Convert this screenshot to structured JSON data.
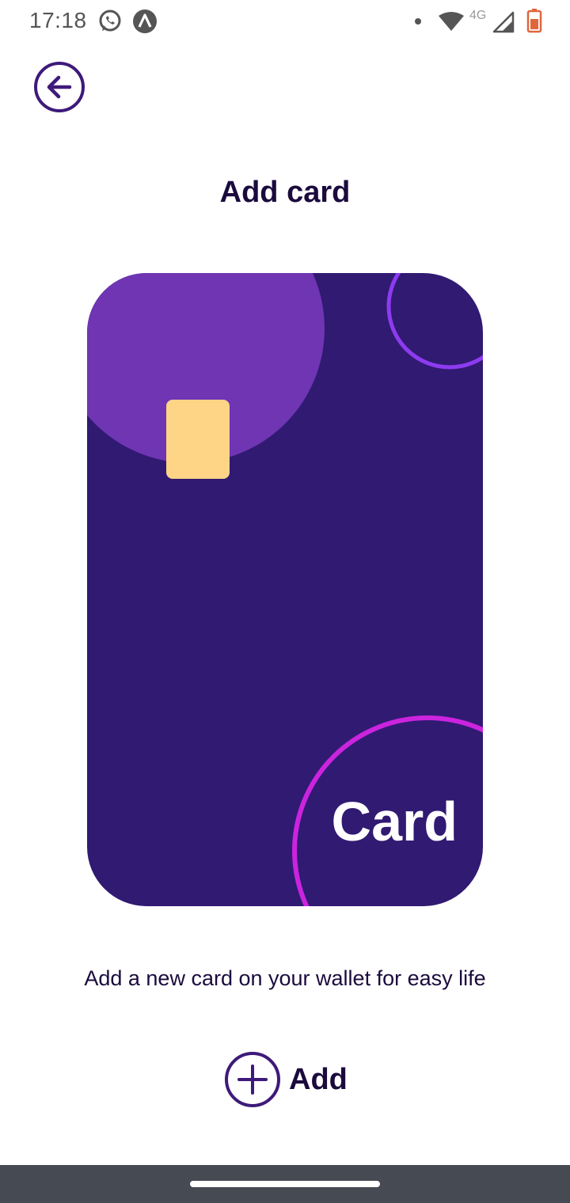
{
  "status_bar": {
    "time": "17:18",
    "network": "4G",
    "icons": [
      "whatsapp-icon",
      "app-notification-icon",
      "notification-dot-icon",
      "wifi-icon",
      "cellular-signal-icon",
      "battery-icon"
    ]
  },
  "header": {
    "back_icon": "arrow-left-circle-icon",
    "title": "Add card"
  },
  "card": {
    "label": "Card",
    "colors": {
      "background": "#311a72",
      "top_circle": "#6f35b3",
      "top_ring": "#8d3bf0",
      "bottom_ring": "#cb24df",
      "chip": "#fed487"
    }
  },
  "description": "Add a new card on your wallet for easy life",
  "add_action": {
    "icon": "plus-circle-icon",
    "label": "Add"
  },
  "colors": {
    "accent": "#3e1a7a",
    "text": "#1b0b3d",
    "nav_bar": "#464a52"
  }
}
